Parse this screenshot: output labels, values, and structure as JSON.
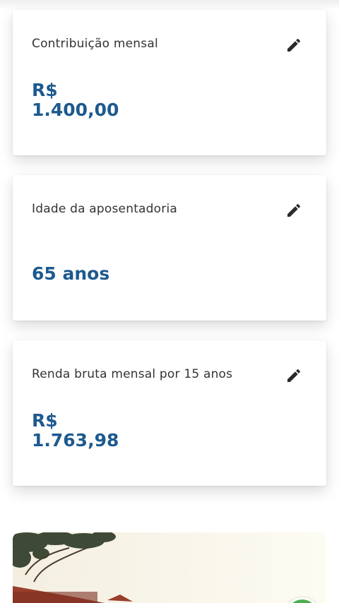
{
  "cards": [
    {
      "label": "Contribuição mensal",
      "value_currency": "R$",
      "value_amount": "1.400,00",
      "edit_icon": "pencil-icon"
    },
    {
      "label": "Idade da aposentadoria",
      "value": "65 anos",
      "edit_icon": "pencil-icon"
    },
    {
      "label": "Renda bruta mensal por 15 anos",
      "value_currency": "R$",
      "value_amount": "1.763,98",
      "edit_icon": "pencil-icon"
    }
  ],
  "colors": {
    "value_text": "#1d5a8f",
    "label_text": "#333333",
    "icon": "#2b2b2b",
    "fab": "#4caf50"
  },
  "promo_image": {
    "icon": "house-photo"
  }
}
